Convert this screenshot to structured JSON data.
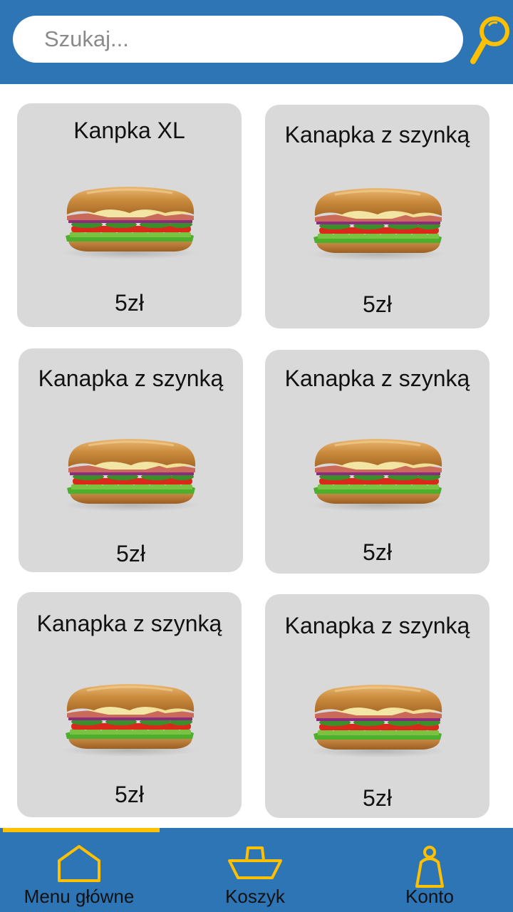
{
  "search": {
    "placeholder": "Szukaj...",
    "icon": "magnifier-icon"
  },
  "products": [
    {
      "name": "Kanpka XL",
      "price": "5zł",
      "image": "sandwich-image"
    },
    {
      "name": "Kanapka z szynką",
      "price": "5zł",
      "image": "sandwich-image"
    },
    {
      "name": "Kanapka z szynką",
      "price": "5zł",
      "image": "sandwich-image"
    },
    {
      "name": "Kanapka z szynką",
      "price": "5zł",
      "image": "sandwich-image"
    },
    {
      "name": "Kanapka z szynką",
      "price": "5zł",
      "image": "sandwich-image"
    },
    {
      "name": "Kanapka z szynką",
      "price": "5zł",
      "image": "sandwich-image"
    }
  ],
  "nav": {
    "items": [
      {
        "label": "Menu główne",
        "icon": "home-icon",
        "active": true
      },
      {
        "label": "Koszyk",
        "icon": "basket-icon",
        "active": false
      },
      {
        "label": "Konto",
        "icon": "person-icon",
        "active": false
      }
    ]
  },
  "colors": {
    "bar": "#2e75b6",
    "accent": "#ffc000",
    "card": "#d9d9d9"
  }
}
